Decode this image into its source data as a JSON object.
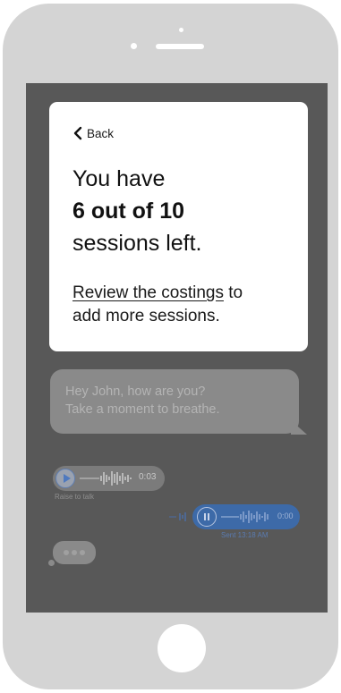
{
  "modal": {
    "back_label": "Back",
    "headline_line1": "You have",
    "headline_line2": "6 out of 10",
    "headline_line3": "sessions left.",
    "link_text": "Review the costings",
    "body_after_link": " to",
    "body_line2": "add more sessions."
  },
  "chat": {
    "message_line1": "Hey John, how are you?",
    "message_line2": "Take a moment to breathe.",
    "voice_in_duration": "0:03",
    "voice_in_hint": "Raise to talk",
    "voice_out_duration": "0:00",
    "voice_out_status": "Sent 13:18 AM"
  },
  "colors": {
    "screen_overlay": "#585858",
    "phone_body": "#d4d4d4",
    "outgoing_bubble": "#3d6aa8"
  }
}
